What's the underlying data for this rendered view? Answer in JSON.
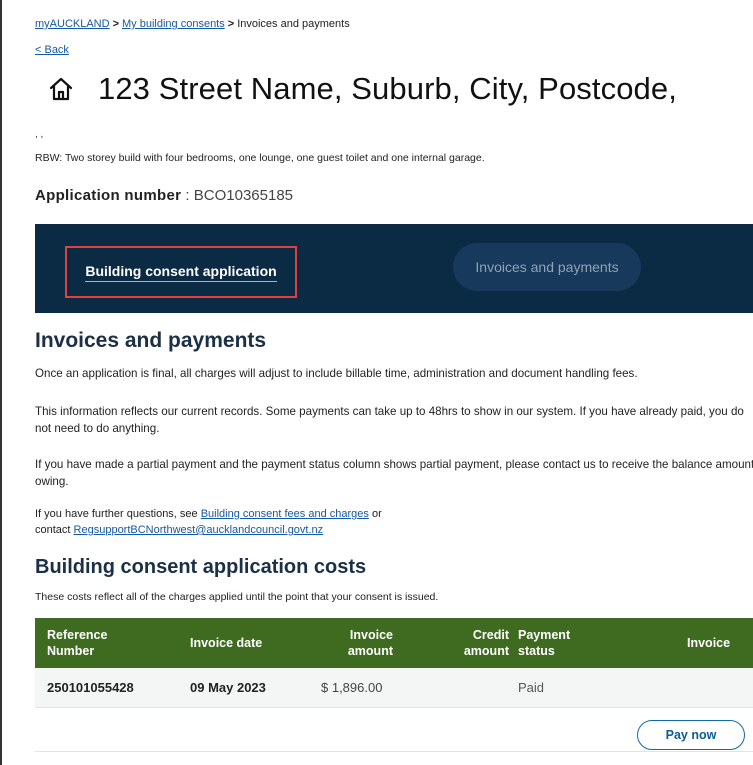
{
  "breadcrumb": {
    "home": "myAUCKLAND",
    "consents": "My building consents",
    "current": "Invoices and payments",
    "separator": ">"
  },
  "back": "< Back",
  "title": "123 Street Name, Suburb, City, Postcode,",
  "title_tail": ", ,",
  "description": "RBW: Two storey build with four bedrooms, one lounge, one guest toilet and one internal garage.",
  "application": {
    "label": "Application number",
    "value": ": BCO10365185"
  },
  "tabs": [
    {
      "label": "Building consent application",
      "active": true
    },
    {
      "label": "Invoices and payments",
      "active": false
    }
  ],
  "invoices": {
    "heading": "Invoices and payments",
    "p1": "Once an application is final, all charges will adjust to include billable time, administration and document handling fees.",
    "p2": "This information reflects our current records. Some payments can take up to 48hrs to show in our system. If you have already paid, you do not need to do anything.",
    "p3": "If you have made a partial payment and the payment status column shows partial payment, please contact us to receive the balance amount owing.",
    "p4_prefix": "If you have further questions, see ",
    "p4_link": "Building consent fees and charges",
    "p4_mid": " or",
    "p4_contact_prefix": "contact ",
    "p4_email": "RegsupportBCNorthwest@aucklandcouncil.govt.nz"
  },
  "costs": {
    "heading": "Building consent application costs",
    "subtitle": "These costs reflect all of the charges applied until the point that your consent is issued.",
    "columns": [
      "Reference Number",
      "Invoice date",
      "Invoice amount",
      "Credit amount",
      "Payment status",
      "Invoice"
    ],
    "rows": [
      {
        "reference": "250101055428",
        "date": "09 May 2023",
        "amount": "$ 1,896.00",
        "credit": "",
        "status": "Paid",
        "invoice": ""
      }
    ],
    "pay_button": "Pay now"
  },
  "colors": {
    "tab_bar": "#0b2a44",
    "table_header": "#3e6b1f",
    "link": "#1558a6",
    "highlight": "#e0413f"
  }
}
